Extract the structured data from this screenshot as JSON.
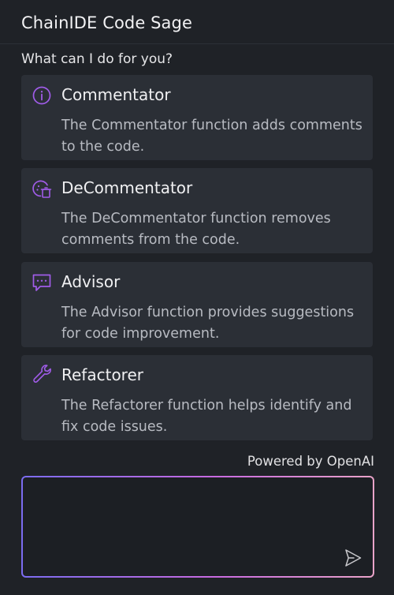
{
  "header": {
    "title": "ChainIDE Code Sage"
  },
  "prompt": "What can I do for you?",
  "cards": [
    {
      "title": "Commentator",
      "desc": "The Commentator function adds comments to the code.",
      "icon": "info-icon"
    },
    {
      "title": "DeCommentator",
      "desc": "The DeCommentator function removes comments from the code.",
      "icon": "trash-icon"
    },
    {
      "title": "Advisor",
      "desc": "The Advisor function provides suggestions for code improvement.",
      "icon": "chat-bubble-icon"
    },
    {
      "title": "Refactorer",
      "desc": "The Refactorer function helps identify and fix code issues.",
      "icon": "wrench-icon"
    }
  ],
  "footer": {
    "powered_by": "Powered by OpenAI"
  },
  "input": {
    "value": "",
    "placeholder": ""
  },
  "colors": {
    "accent": "#9b59e8",
    "card_bg": "#2b2f36",
    "panel_bg": "#1f2227"
  }
}
